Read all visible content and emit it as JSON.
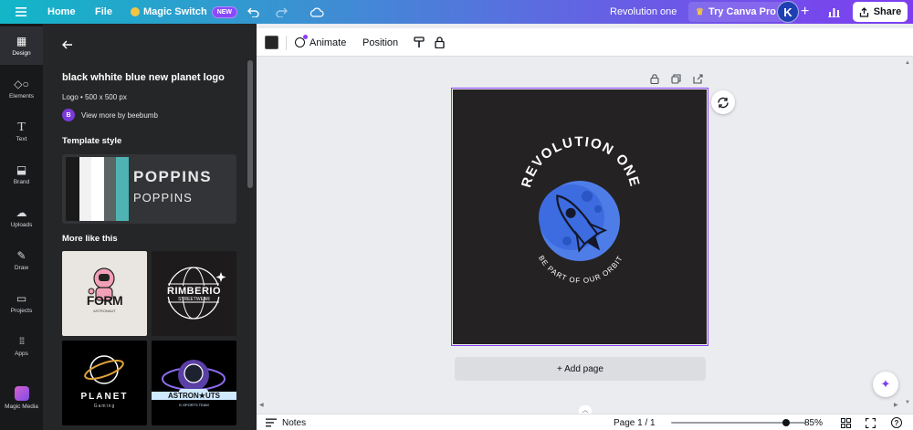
{
  "topbar": {
    "home": "Home",
    "file": "File",
    "magic_switch": "Magic Switch",
    "new_badge": "NEW",
    "doc_title": "Revolution one",
    "try_pro": "Try Canva Pro",
    "avatar_initial": "K",
    "share": "Share"
  },
  "rail": {
    "items": [
      {
        "label": "Design",
        "icon": "design-icon"
      },
      {
        "label": "Elements",
        "icon": "elements-icon"
      },
      {
        "label": "Text",
        "icon": "text-icon"
      },
      {
        "label": "Brand",
        "icon": "brand-icon"
      },
      {
        "label": "Uploads",
        "icon": "uploads-icon"
      },
      {
        "label": "Draw",
        "icon": "draw-icon"
      },
      {
        "label": "Projects",
        "icon": "projects-icon"
      },
      {
        "label": "Apps",
        "icon": "apps-icon"
      },
      {
        "label": "Magic Media",
        "icon": "magic-media-icon"
      }
    ]
  },
  "panel": {
    "template_title": "black whhite blue new planet logo",
    "template_meta": "Logo • 500 x 500 px",
    "author_initial": "B",
    "author_link": "View more by beebumb",
    "template_style_heading": "Template style",
    "font_heading": "POPPINS",
    "font_body": "POPPINS",
    "style_colors": [
      "#1a1a1a",
      "#f2f2f2",
      "#ffffff",
      "#5c6566",
      "#4fb3b3"
    ],
    "more_like_heading": "More like this",
    "thumbnails": [
      {
        "title": "FORM",
        "sub": "ASTRONAUT"
      },
      {
        "title": "RIMBERIO",
        "sub": "STREETWEAR"
      },
      {
        "title": "PLANET",
        "sub": "Gaming"
      },
      {
        "title": "ASTRON★UTS",
        "sub": "E-SPORTS TEAM"
      }
    ]
  },
  "context_toolbar": {
    "animate": "Animate",
    "position": "Position"
  },
  "canvas": {
    "logo_top_text": "REVOLUTION ONE",
    "logo_bottom_text": "BE PART OF OUR ORBIT",
    "add_page": "+ Add page"
  },
  "bottombar": {
    "notes": "Notes",
    "page_indicator": "Page 1 / 1",
    "zoom_value": 0.85,
    "zoom_label": "85%"
  }
}
